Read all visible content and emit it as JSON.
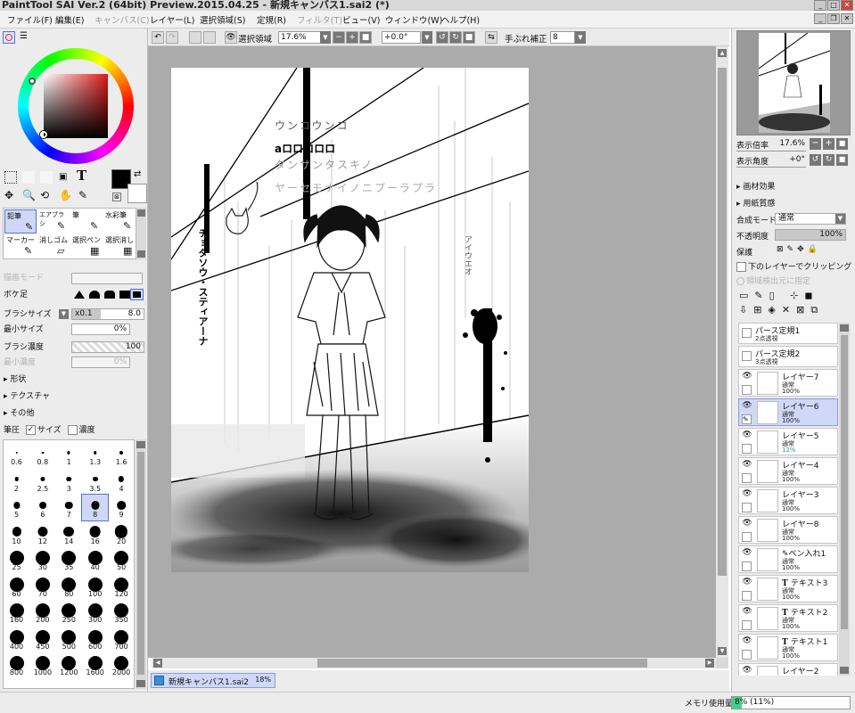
{
  "window": {
    "title": "PaintTool SAI Ver.2 (64bit) Preview.2015.04.25 - 新規キャンバス1.sai2 (*)"
  },
  "menu": [
    "ファイル(F)",
    "編集(E)",
    "キャンバス(C)",
    "レイヤー(L)",
    "選択領域(S)",
    "定規(R)",
    "フィルタ(T)",
    "ビュー(V)",
    "ウィンドウ(W)",
    "ヘルプ(H)"
  ],
  "toolbar": {
    "selection_label": "選択領域",
    "zoom": "17.6%",
    "rotation": "+0.0°",
    "stabilizer_label": "手ぶれ補正",
    "stabilizer": "8"
  },
  "colors": {
    "accent": "#5a6fd6",
    "canvas_bg": "#ababab"
  },
  "tools": {
    "text_tool": "T",
    "brushes": [
      "鉛筆",
      "エアブラシ",
      "筆",
      "水彩筆",
      "マーカー",
      "消しゴム",
      "選択ペン",
      "選択消し"
    ]
  },
  "brush_settings": {
    "draw_mode_label": "描画モード",
    "blur_label": "ボケ足",
    "brush_size_label": "ブラシサイズ",
    "brush_size_mult": "x0.1",
    "brush_size_value": "8.0",
    "min_size_label": "最小サイズ",
    "min_size_value": "0%",
    "density_label": "ブラシ濃度",
    "density_value": "100",
    "min_density_label": "最小濃度",
    "min_density_value": "0%",
    "shape": "形状",
    "texture": "テクスチャ",
    "other": "その他",
    "pressure_label": "筆圧",
    "size_cb": "サイズ",
    "density_cb": "濃度"
  },
  "brush_sizes": [
    "0.6",
    "0.8",
    "1",
    "1.3",
    "1.6",
    "2",
    "2.5",
    "3",
    "3.5",
    "4",
    "5",
    "6",
    "7",
    "8",
    "9",
    "10",
    "12",
    "14",
    "16",
    "20",
    "25",
    "30",
    "35",
    "40",
    "50",
    "60",
    "70",
    "80",
    "100",
    "120",
    "160",
    "200",
    "250",
    "300",
    "350",
    "400",
    "450",
    "500",
    "600",
    "700",
    "800",
    "1000",
    "1200",
    "1600",
    "2000"
  ],
  "brush_size_selected": "8",
  "canvas_text": {
    "l1": "ウンコウンコ",
    "l2": "aロロロロロ",
    "l3": "タンサンタスキノ",
    "l4": "ヤーセモナイノニプーラプラ",
    "vertical1": "チョダソウ・スティアーナ",
    "vertical2": "アイウエオ"
  },
  "navigator": {
    "zoom_label": "表示倍率",
    "zoom": "17.6%",
    "angle_label": "表示角度",
    "angle": "+0°"
  },
  "layer_props": {
    "paper_effect": "画材効果",
    "paper_texture": "用紙質感",
    "blend_label": "合成モード",
    "blend": "通常",
    "opacity_label": "不透明度",
    "opacity": "100%",
    "protect_label": "保護",
    "clip_label": "下のレイヤーでクリッピング",
    "selsrc_label": "領域検出元に指定"
  },
  "layers": [
    {
      "name": "パース定規1",
      "mode": "2点透視",
      "opacity": "",
      "type": "ruler"
    },
    {
      "name": "パース定規2",
      "mode": "3点透視",
      "opacity": "",
      "type": "ruler"
    },
    {
      "name": "レイヤー7",
      "mode": "通常",
      "opacity": "100%",
      "type": "layer"
    },
    {
      "name": "レイヤー6",
      "mode": "通常",
      "opacity": "100%",
      "type": "layer",
      "selected": true
    },
    {
      "name": "レイヤー5",
      "mode": "通常",
      "opacity": "12%",
      "type": "layer"
    },
    {
      "name": "レイヤー4",
      "mode": "通常",
      "opacity": "100%",
      "type": "layer"
    },
    {
      "name": "レイヤー3",
      "mode": "通常",
      "opacity": "100%",
      "type": "layer"
    },
    {
      "name": "レイヤー8",
      "mode": "通常",
      "opacity": "100%",
      "type": "layer"
    },
    {
      "name": "ペン入れ1",
      "mode": "通常",
      "opacity": "100%",
      "type": "pen"
    },
    {
      "name": "テキスト3",
      "mode": "通常",
      "opacity": "100%",
      "type": "text"
    },
    {
      "name": "テキスト2",
      "mode": "通常",
      "opacity": "100%",
      "type": "text"
    },
    {
      "name": "テキスト1",
      "mode": "通常",
      "opacity": "100%",
      "type": "text"
    },
    {
      "name": "レイヤー2",
      "mode": "通常",
      "opacity": "100%",
      "type": "layer"
    }
  ],
  "tab": {
    "name": "新規キャンバス1.sai2",
    "zoom": "18%"
  },
  "status": {
    "memory_label": "メモリ使用量",
    "memory_value": "8% (11%)",
    "memory_percent": 8
  }
}
